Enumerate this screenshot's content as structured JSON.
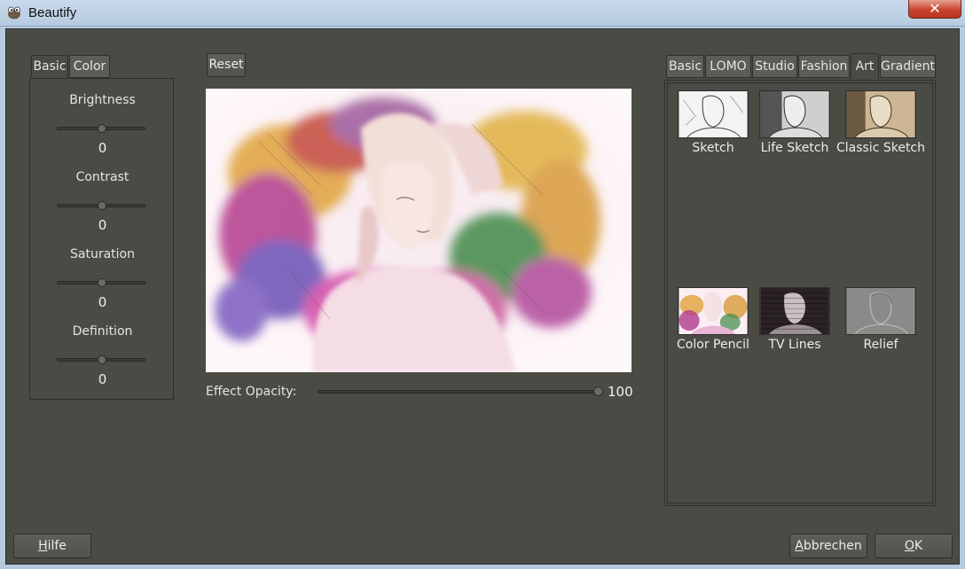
{
  "window": {
    "title": "Beautify",
    "close_glyph": "✕"
  },
  "left_tabs": [
    "Basic",
    "Color"
  ],
  "adjustments": [
    {
      "label": "Brightness",
      "value": "0"
    },
    {
      "label": "Contrast",
      "value": "0"
    },
    {
      "label": "Saturation",
      "value": "0"
    },
    {
      "label": "Definition",
      "value": "0"
    }
  ],
  "reset_label": "Reset",
  "effect_opacity": {
    "label": "Effect Opacity:",
    "value": "100",
    "level": 1.0
  },
  "effect_tabs": [
    "Basic",
    "LOMO",
    "Studio",
    "Fashion",
    "Art",
    "Gradient"
  ],
  "active_effect_tab": "Art",
  "effects": [
    {
      "label": "Sketch",
      "icon": "sketch-thumbnail"
    },
    {
      "label": "Life Sketch",
      "icon": "life-sketch-thumbnail"
    },
    {
      "label": "Classic Sketch",
      "icon": "classic-sketch-thumbnail"
    },
    {
      "label": "Color Pencil",
      "icon": "color-pencil-thumbnail"
    },
    {
      "label": "TV Lines",
      "icon": "tv-lines-thumbnail"
    },
    {
      "label": "Relief",
      "icon": "relief-thumbnail"
    }
  ],
  "footer": {
    "help": {
      "mnemonic": "H",
      "rest": "ilfe"
    },
    "cancel": {
      "mnemonic": "A",
      "rest": "bbrechen"
    },
    "ok": {
      "mnemonic": "O",
      "rest": "K"
    }
  },
  "colors": {
    "dialog_bg": "#4b4b46",
    "titlebar": "#c9d9ea",
    "close_button": "#c9452f"
  }
}
